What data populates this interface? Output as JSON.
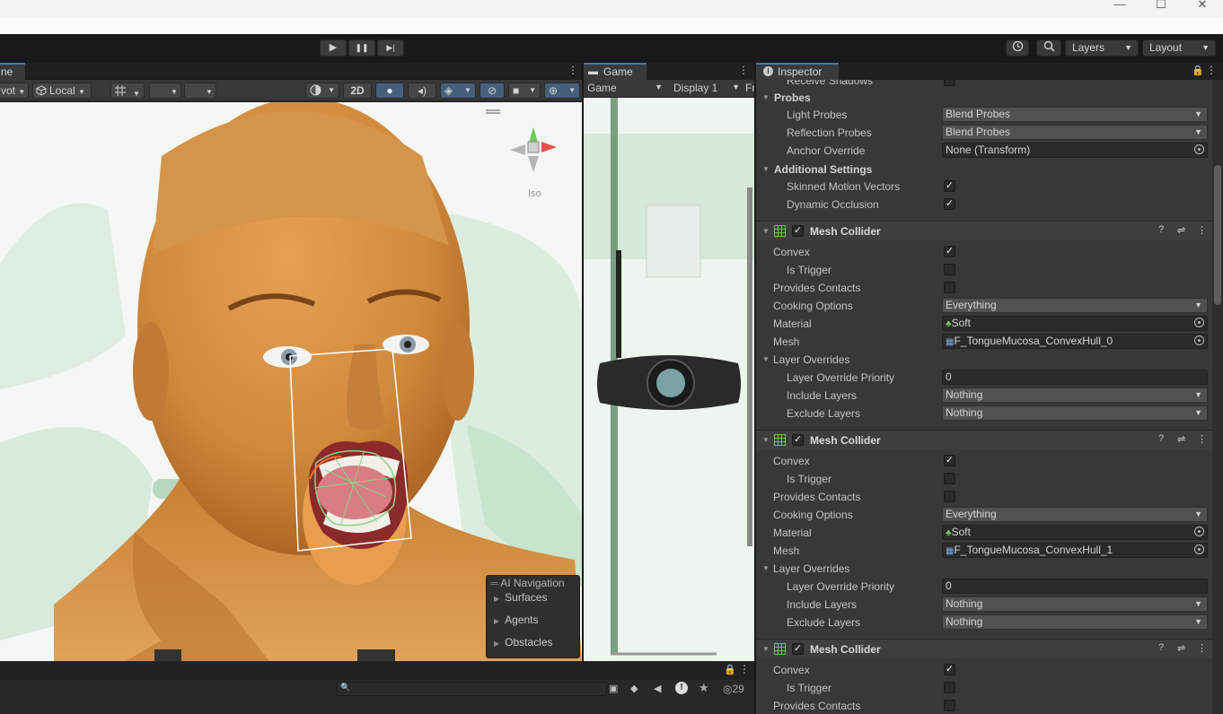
{
  "toolbar": {
    "layers_label": "Layers",
    "layout_label": "Layout",
    "play": "▶",
    "pause": "❚❚",
    "step": "▶|"
  },
  "window": {
    "minimize": "—",
    "maximize": "☐",
    "close": "✕"
  },
  "scene": {
    "tab_label": "ne",
    "pivot_label": "vot",
    "local_label": "Local",
    "btn_2d": "2D",
    "iso_label": "Iso",
    "ai_nav": {
      "title": "AI Navigation",
      "items": [
        "Surfaces",
        "Agents",
        "Obstacles"
      ]
    }
  },
  "game": {
    "tab_label": "Game",
    "dropdown_game": "Game",
    "display_label": "Display 1",
    "fr_label": "Fr"
  },
  "bottom": {
    "count": "29"
  },
  "inspector": {
    "tab_label": "Inspector",
    "receive_shadows": "Receive Shadows",
    "probes": {
      "header": "Probes",
      "light_label": "Light Probes",
      "light_value": "Blend Probes",
      "refl_label": "Reflection Probes",
      "refl_value": "Blend Probes",
      "anchor_label": "Anchor Override",
      "anchor_value": "None (Transform)"
    },
    "additional": {
      "header": "Additional Settings",
      "skinned_label": "Skinned Motion Vectors",
      "dynamic_label": "Dynamic Occlusion"
    },
    "colliders": [
      {
        "name": "Mesh Collider",
        "convex": "Convex",
        "trigger": "Is Trigger",
        "contacts": "Provides Contacts",
        "cooking_label": "Cooking Options",
        "cooking_value": "Everything",
        "material_label": "Material",
        "material_value": "Soft",
        "mesh_label": "Mesh",
        "mesh_value": "F_TongueMucosa_ConvexHull_0",
        "overrides": "Layer Overrides",
        "priority_label": "Layer Override Priority",
        "priority_value": "0",
        "include_label": "Include Layers",
        "include_value": "Nothing",
        "exclude_label": "Exclude Layers",
        "exclude_value": "Nothing"
      },
      {
        "name": "Mesh Collider",
        "convex": "Convex",
        "trigger": "Is Trigger",
        "contacts": "Provides Contacts",
        "cooking_label": "Cooking Options",
        "cooking_value": "Everything",
        "material_label": "Material",
        "material_value": "Soft",
        "mesh_label": "Mesh",
        "mesh_value": "F_TongueMucosa_ConvexHull_1",
        "overrides": "Layer Overrides",
        "priority_label": "Layer Override Priority",
        "priority_value": "0",
        "include_label": "Include Layers",
        "include_value": "Nothing",
        "exclude_label": "Exclude Layers",
        "exclude_value": "Nothing"
      },
      {
        "name": "Mesh Collider",
        "convex": "Convex",
        "trigger": "Is Trigger",
        "contacts": "Provides Contacts"
      }
    ]
  }
}
